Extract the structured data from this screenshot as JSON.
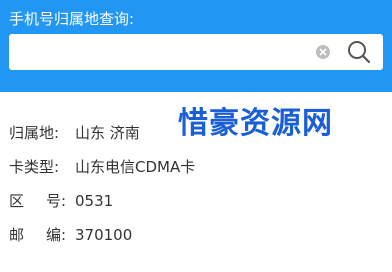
{
  "header": {
    "query_label": "手机号归属地查询:"
  },
  "search": {
    "input_value": "",
    "placeholder": ""
  },
  "result": {
    "location_label": "归属地:",
    "location_value": "山东 济南",
    "card_type_label": "卡类型:",
    "card_type_value": "山东电信CDMA卡",
    "area_code_label_1": "区",
    "area_code_label_2": "号",
    "area_code_label_3": ":",
    "area_code_value": "0531",
    "postcode_label_1": "邮",
    "postcode_label_2": "编",
    "postcode_label_3": ":",
    "postcode_value": "370100"
  },
  "watermark": {
    "text": "惜豪资源网"
  },
  "colors": {
    "header_background": "#2196f3",
    "watermark": "#1a5fd6"
  },
  "icons": {
    "clear": "clear-icon",
    "search": "search-icon"
  }
}
